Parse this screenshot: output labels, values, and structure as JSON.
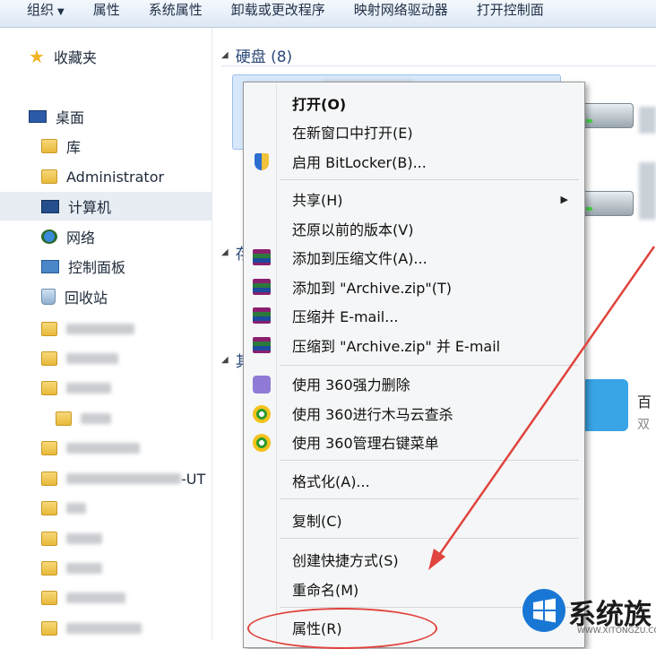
{
  "toolbar": {
    "organize_label": "组织",
    "properties_label": "属性",
    "system_properties_label": "系统属性",
    "uninstall_label": "卸载或更改程序",
    "map_drive_label": "映射网络驱动器",
    "open_control_panel_label": "打开控制面"
  },
  "nav": {
    "favorites_label": "收藏夹",
    "desktop_label": "桌面",
    "library_label": "库",
    "admin_label": "Administrator",
    "computer_label": "计算机",
    "network_label": "网络",
    "control_panel_label": "控制面板",
    "recycle_bin_label": "回收站",
    "partial_folder_suffix": "-UT"
  },
  "main": {
    "group_drives_label": "硬盘 (8)",
    "group_other_label": "存",
    "group_third_label": "其",
    "baidu_label": "百",
    "baidu_sub_label": "双"
  },
  "context_menu": {
    "open": "打开(O)",
    "open_new_window": "在新窗口中打开(E)",
    "bitlocker": "启用 BitLocker(B)...",
    "share": "共享(H)",
    "restore_versions": "还原以前的版本(V)",
    "add_archive": "添加到压缩文件(A)...",
    "add_to_zip": "添加到 \"Archive.zip\"(T)",
    "compress_email": "压缩并 E-mail...",
    "compress_zip_email": "压缩到 \"Archive.zip\" 并 E-mail",
    "del_360": "使用 360强力删除",
    "scan_360": "使用 360进行木马云查杀",
    "manage_360": "使用 360管理右键菜单",
    "format": "格式化(A)...",
    "copy": "复制(C)",
    "create_shortcut": "创建快捷方式(S)",
    "rename": "重命名(M)",
    "properties": "属性(R)"
  },
  "watermark": {
    "brand": "系统族",
    "url": "WWW.XITONGZU.COM"
  },
  "colors": {
    "annotation_red": "#e0443e",
    "toolbar_bg": "#dde8f5",
    "selection_bg": "#d8e8fb"
  }
}
